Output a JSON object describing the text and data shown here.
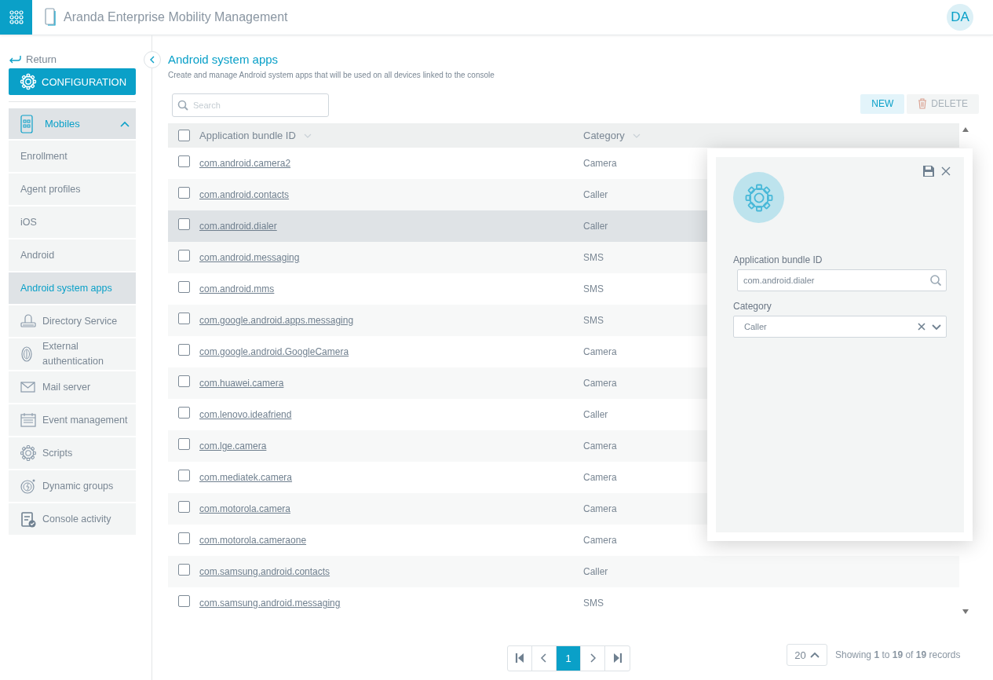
{
  "header": {
    "title": "Aranda Enterprise Mobility Management",
    "avatar": "DA"
  },
  "sidebar": {
    "return": "Return",
    "section": "CONFIGURATION",
    "groups": [
      {
        "label": "Mobiles",
        "expanded": true,
        "children": [
          {
            "label": "Enrollment",
            "selected": false
          },
          {
            "label": "Agent profiles",
            "selected": false
          },
          {
            "label": "iOS",
            "selected": false
          },
          {
            "label": "Android",
            "selected": false
          },
          {
            "label": "Android system apps",
            "selected": true
          }
        ]
      },
      {
        "label": "Directory Service",
        "selected": false
      },
      {
        "label": "External authentication",
        "selected": false
      },
      {
        "label": "Mail server",
        "selected": false
      },
      {
        "label": "Event management",
        "selected": false
      },
      {
        "label": "Scripts",
        "selected": false
      },
      {
        "label": "Dynamic groups",
        "selected": false
      },
      {
        "label": "Console activity",
        "selected": false
      }
    ]
  },
  "page": {
    "title": "Android system apps",
    "subtitle": "Create and manage Android system apps that will be used on all devices linked to the console"
  },
  "toolbar": {
    "search": {
      "placeholder": "Search"
    },
    "buttons": [
      {
        "label": "NEW",
        "kind": "primary"
      },
      {
        "label": "DELETE",
        "kind": "delete"
      }
    ]
  },
  "table": {
    "select_all_checked": false,
    "columns": [
      "Application bundle ID",
      "Category"
    ],
    "rows": [
      {
        "id": "com.android.camera2",
        "category": "Camera",
        "checked": false,
        "selected": false
      },
      {
        "id": "com.android.contacts",
        "category": "Caller",
        "checked": false,
        "selected": false
      },
      {
        "id": "com.android.dialer",
        "category": "Caller",
        "checked": false,
        "selected": true
      },
      {
        "id": "com.android.messaging",
        "category": "SMS",
        "checked": false,
        "selected": false
      },
      {
        "id": "com.android.mms",
        "category": "SMS",
        "checked": false,
        "selected": false
      },
      {
        "id": "com.google.android.apps.messaging",
        "category": "SMS",
        "checked": false,
        "selected": false
      },
      {
        "id": "com.google.android.GoogleCamera",
        "category": "Camera",
        "checked": false,
        "selected": false
      },
      {
        "id": "com.huawei.camera",
        "category": "Camera",
        "checked": false,
        "selected": false
      },
      {
        "id": "com.lenovo.ideafriend",
        "category": "Caller",
        "checked": false,
        "selected": false
      },
      {
        "id": "com.lge.camera",
        "category": "Camera",
        "checked": false,
        "selected": false
      },
      {
        "id": "com.mediatek.camera",
        "category": "Camera",
        "checked": false,
        "selected": false
      },
      {
        "id": "com.motorola.camera",
        "category": "Camera",
        "checked": false,
        "selected": false
      },
      {
        "id": "com.motorola.cameraone",
        "category": "Camera",
        "checked": false,
        "selected": false
      },
      {
        "id": "com.samsung.android.contacts",
        "category": "Caller",
        "checked": false,
        "selected": false
      },
      {
        "id": "com.samsung.android.messaging",
        "category": "SMS",
        "checked": false,
        "selected": false
      }
    ]
  },
  "pagination": {
    "pages": [
      {
        "label": "1",
        "selected": true
      }
    ],
    "page_size": "20",
    "summary": "Showing **1** to **19** of **19** records"
  },
  "detail_panel": {
    "fields": [
      {
        "label": "Application bundle ID",
        "value": "com.android.dialer",
        "kind": "search"
      },
      {
        "label": "Category",
        "value": "Caller",
        "kind": "select"
      }
    ]
  }
}
